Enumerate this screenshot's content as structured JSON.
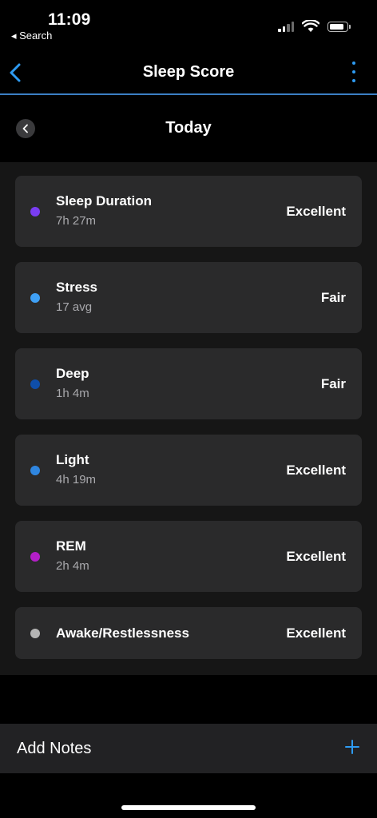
{
  "status_bar": {
    "time": "11:09",
    "back_label": "◂ Search"
  },
  "nav": {
    "title": "Sleep Score",
    "back_icon": "chevron-left-icon",
    "more_icon": "more-vertical-icon"
  },
  "day": {
    "title": "Today"
  },
  "metrics": [
    {
      "label": "Sleep Duration",
      "sub": "7h 27m",
      "rating": "Excellent",
      "color": "#7a3df2"
    },
    {
      "label": "Stress",
      "sub": "17 avg",
      "rating": "Fair",
      "color": "#3fa0f5"
    },
    {
      "label": "Deep",
      "sub": "1h 4m",
      "rating": "Fair",
      "color": "#0f4ea8"
    },
    {
      "label": "Light",
      "sub": "4h 19m",
      "rating": "Excellent",
      "color": "#2f86e0"
    },
    {
      "label": "REM",
      "sub": "2h 4m",
      "rating": "Excellent",
      "color": "#b31fc7"
    },
    {
      "label": "Awake/Restlessness",
      "sub": "",
      "rating": "Excellent",
      "color": "#b4b4b4"
    }
  ],
  "notes": {
    "label": "Add Notes"
  },
  "colors": {
    "accent": "#2e9bf2",
    "card": "#2a2a2b",
    "background": "#000000"
  }
}
